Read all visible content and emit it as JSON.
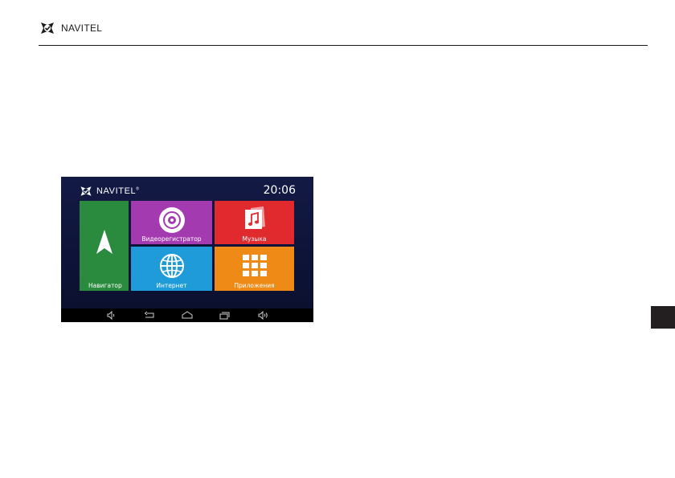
{
  "header": {
    "brand": "NAVITEL"
  },
  "device": {
    "brand": "NAVITEL",
    "brand_mark": "®",
    "time": "20:06",
    "tiles": [
      {
        "id": "navigator",
        "label": "Навигатор",
        "color": "#2a8a3e",
        "icon": "navigation-arrow-icon"
      },
      {
        "id": "dvr",
        "label": "Видеорегистратор",
        "color": "#a33ab0",
        "icon": "camera-lens-icon"
      },
      {
        "id": "music",
        "label": "Музыка",
        "color": "#e02a2e",
        "icon": "music-note-icon"
      },
      {
        "id": "internet",
        "label": "Интернет",
        "color": "#1e9bd8",
        "icon": "globe-icon"
      },
      {
        "id": "apps",
        "label": "Приложения",
        "color": "#f08a17",
        "icon": "grid-icon"
      }
    ],
    "navbar": [
      "volume-down-icon",
      "back-icon",
      "home-icon",
      "recent-apps-icon",
      "volume-up-icon"
    ]
  },
  "colors": {
    "page_bg": "#ffffff",
    "device_bg": "#0e1438",
    "side_tab": "#231f20"
  }
}
